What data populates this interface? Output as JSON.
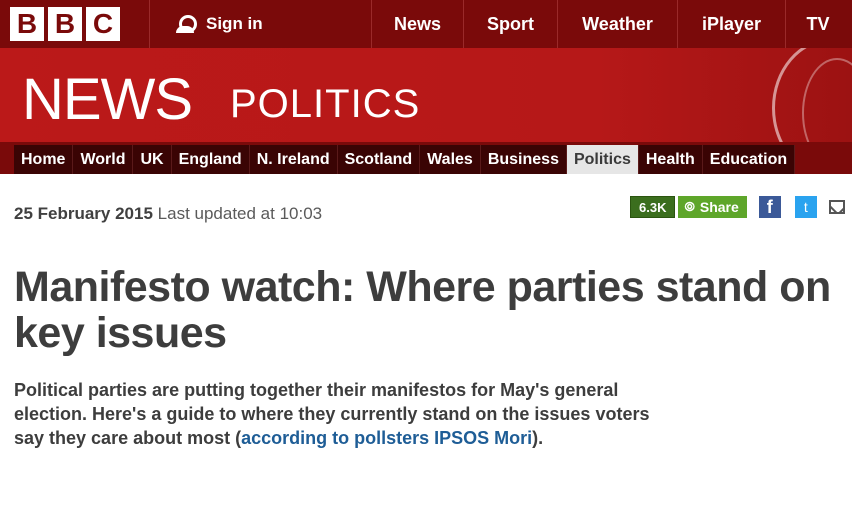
{
  "topbar": {
    "logo_letters": [
      "B",
      "B",
      "C"
    ],
    "signin_label": "Sign in",
    "nav": [
      "News",
      "Sport",
      "Weather",
      "iPlayer",
      "TV"
    ]
  },
  "masthead": {
    "brand": "NEWS",
    "section": "POLITICS"
  },
  "section_nav": {
    "items": [
      "Home",
      "World",
      "UK",
      "England",
      "N. Ireland",
      "Scotland",
      "Wales",
      "Business",
      "Politics",
      "Health",
      "Education"
    ],
    "active": "Politics"
  },
  "article": {
    "date": "25 February 2015",
    "updated": "Last updated at 10:03",
    "share_count": "6.3K",
    "share_label": "Share",
    "facebook_glyph": "f",
    "twitter_glyph": "t",
    "headline": "Manifesto watch: Where parties stand on key issues",
    "summary_text": "Political parties are putting together their manifestos for May's general election. Here's a guide to where they currently stand on the issues voters say they care about most (",
    "summary_link": "according to pollsters IPSOS Mori",
    "summary_end": ")."
  },
  "colors": {
    "bbc_red": "#bb1919",
    "dark_red": "#7a0a0a",
    "share_green": "#5ea62a",
    "link_blue": "#1e5d96"
  },
  "icons": [
    "user-icon",
    "share-icon",
    "facebook-icon",
    "twitter-icon",
    "email-icon"
  ]
}
